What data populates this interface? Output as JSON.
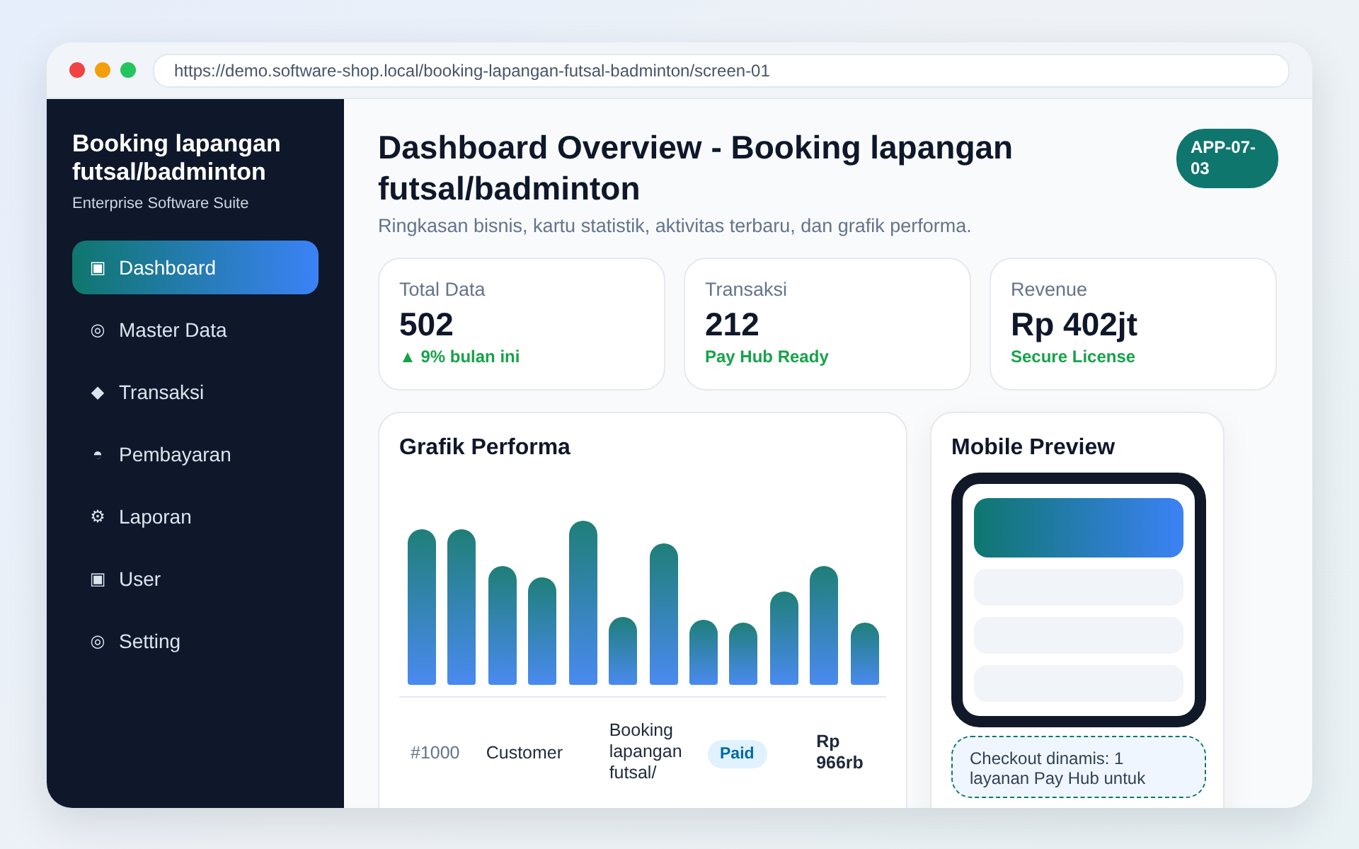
{
  "browser": {
    "url": "https://demo.software-shop.local/booking-lapangan-futsal-badminton/screen-01"
  },
  "sidebar": {
    "title": "Booking lapangan futsal/badminton",
    "subtitle": "Enterprise Software Suite",
    "items": [
      {
        "icon": "▣",
        "label": "Dashboard",
        "selected": true
      },
      {
        "icon": "◎",
        "label": "Master Data",
        "selected": false
      },
      {
        "icon": "◆",
        "label": "Transaksi",
        "selected": false
      },
      {
        "icon": "◓",
        "label": "Pembayaran",
        "selected": false
      },
      {
        "icon": "⚙",
        "label": "Laporan",
        "selected": false
      },
      {
        "icon": "▣",
        "label": "User",
        "selected": false
      },
      {
        "icon": "◎",
        "label": "Setting",
        "selected": false
      }
    ]
  },
  "header": {
    "title": "Dashboard Overview - Booking lapangan futsal/badminton",
    "badge": "APP-07-03",
    "subtitle": "Ringkasan bisnis, kartu statistik, aktivitas terbaru, dan grafik performa."
  },
  "stats": [
    {
      "label": "Total Data",
      "value": "502",
      "note": "▲ 9% bulan ini"
    },
    {
      "label": "Transaksi",
      "value": "212",
      "note": "Pay Hub Ready"
    },
    {
      "label": "Revenue",
      "value": "Rp 402jt",
      "note": "Secure License"
    }
  ],
  "chart_card": {
    "title": "Grafik Performa",
    "rows": [
      {
        "id": "#1000",
        "customer": "Customer",
        "item": "Booking lapangan futsal/",
        "status": "Paid",
        "amount": "Rp 966rb"
      }
    ]
  },
  "mobile_preview": {
    "title": "Mobile Preview",
    "note": "Checkout dinamis: 1 layanan Pay Hub untuk"
  }
}
